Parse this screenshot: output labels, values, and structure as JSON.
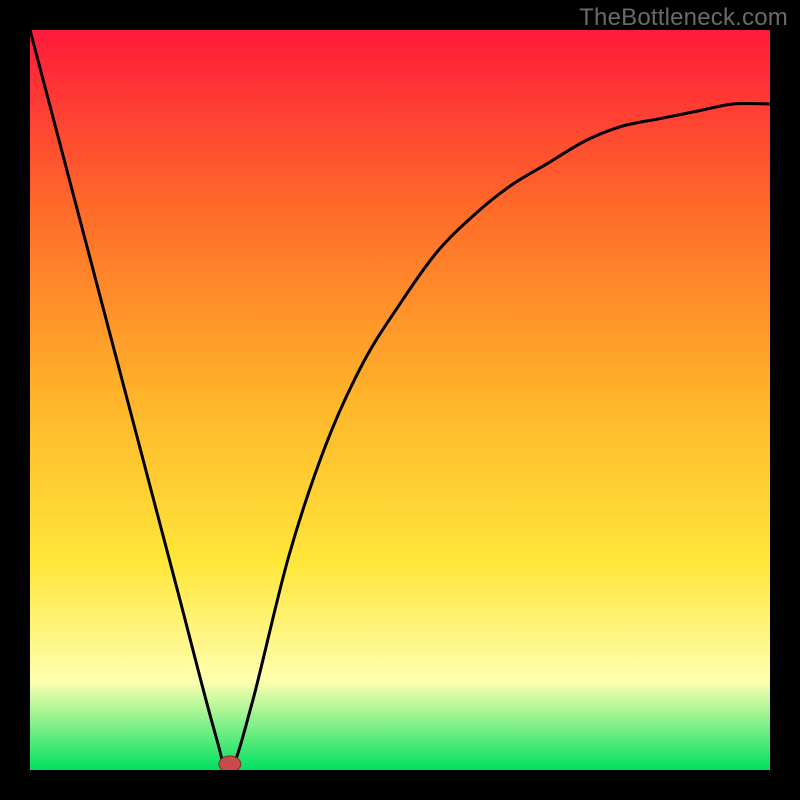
{
  "attribution": "TheBottleneck.com",
  "chart_data": {
    "type": "line",
    "title": "",
    "xlabel": "",
    "ylabel": "",
    "xlim": [
      0,
      100
    ],
    "ylim": [
      0,
      100
    ],
    "grid": false,
    "legend": false,
    "series": [
      {
        "name": "curve",
        "x": [
          0,
          5,
          10,
          15,
          20,
          25,
          27,
          30,
          35,
          40,
          45,
          50,
          55,
          60,
          65,
          70,
          75,
          80,
          85,
          90,
          95,
          100
        ],
        "y": [
          100,
          81,
          62,
          43,
          24,
          5,
          0,
          9,
          29,
          44,
          55,
          63,
          70,
          75,
          79,
          82,
          85,
          87,
          88,
          89,
          90,
          90
        ]
      }
    ],
    "marker": {
      "x": 27,
      "y": 0
    },
    "gradient_colors": {
      "top": "#ff1a3a",
      "upper_mid": "#ff6a2a",
      "mid": "#ffb52a",
      "lower_mid": "#ffe63a",
      "pale": "#ffffb0",
      "bottom": "#00e060"
    }
  }
}
